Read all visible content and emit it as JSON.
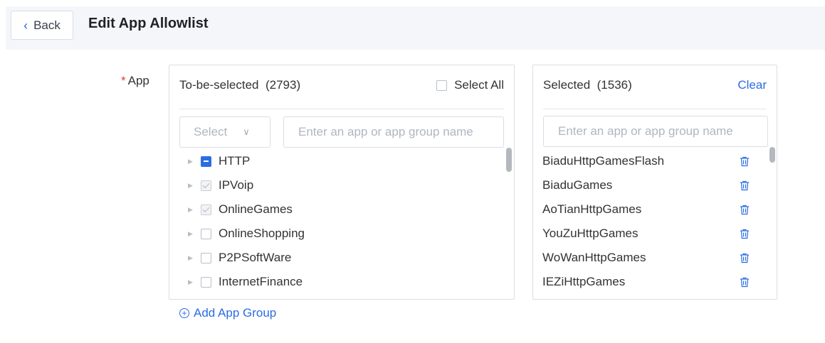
{
  "header": {
    "back_label": "Back",
    "title": "Edit App Allowlist"
  },
  "form": {
    "required_mark": "*",
    "app_label": "App"
  },
  "left_panel": {
    "title": "To-be-selected",
    "count": "(2793)",
    "select_all_label": "Select All",
    "filter_placeholder": "Select",
    "search_placeholder": "Enter an app or app group name",
    "items": [
      {
        "label": "HTTP",
        "state": "indeterminate"
      },
      {
        "label": "IPVoip",
        "state": "checked-disabled"
      },
      {
        "label": "OnlineGames",
        "state": "checked-disabled"
      },
      {
        "label": "OnlineShopping",
        "state": "unchecked"
      },
      {
        "label": "P2PSoftWare",
        "state": "unchecked"
      },
      {
        "label": "InternetFinance",
        "state": "unchecked"
      }
    ]
  },
  "right_panel": {
    "title": "Selected",
    "count": "(1536)",
    "clear_label": "Clear",
    "search_placeholder": "Enter an app or app group name",
    "items": [
      {
        "label": "BiaduHttpGamesFlash"
      },
      {
        "label": "BiaduGames"
      },
      {
        "label": "AoTianHttpGames"
      },
      {
        "label": "YouZuHttpGames"
      },
      {
        "label": "WoWanHttpGames"
      },
      {
        "label": "IEZiHttpGames"
      }
    ]
  },
  "footer": {
    "add_group_label": "Add App Group"
  },
  "colors": {
    "accent": "#2b6de3",
    "required": "#e63b3b",
    "header_bg": "#f4f6fa"
  }
}
